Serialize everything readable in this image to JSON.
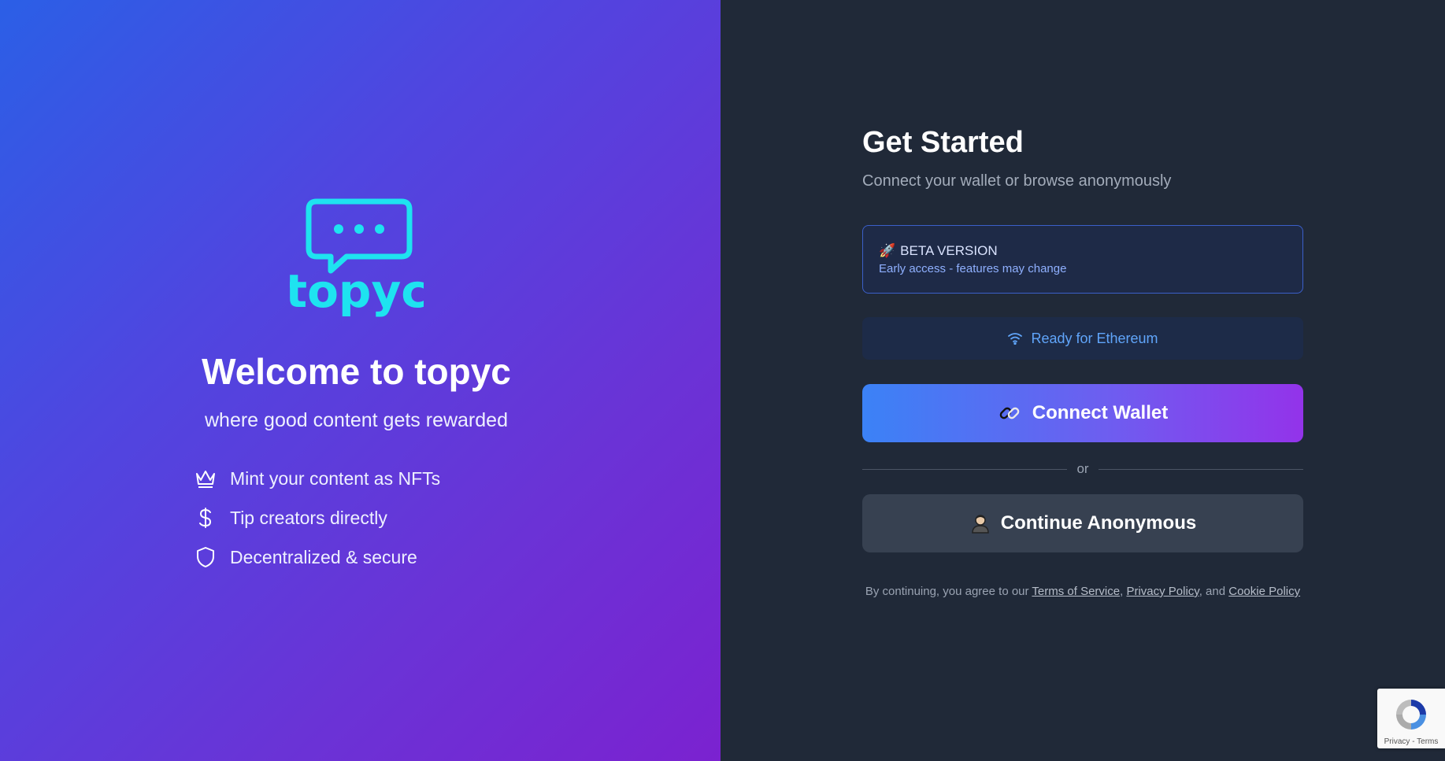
{
  "brand": {
    "name": "topyc",
    "logo_color": "#1ee3f0"
  },
  "welcome": {
    "title": "Welcome to topyc",
    "subtitle": "where good content gets rewarded",
    "features": [
      {
        "icon": "crown-icon",
        "label": "Mint your content as NFTs"
      },
      {
        "icon": "dollar-icon",
        "label": "Tip creators directly"
      },
      {
        "icon": "shield-icon",
        "label": "Decentralized & secure"
      }
    ]
  },
  "auth": {
    "title": "Get Started",
    "subtitle": "Connect your wallet or browse anonymously",
    "beta": {
      "icon": "rocket-icon",
      "title": "BETA VERSION",
      "description": "Early access - features may change"
    },
    "network_status": {
      "icon": "wifi-icon",
      "label": "Ready for Ethereum"
    },
    "connect_button": {
      "icon": "link-icon",
      "label": "Connect Wallet"
    },
    "divider_text": "or",
    "anonymous_button": {
      "icon": "incognito-icon",
      "label": "Continue Anonymous"
    },
    "terms": {
      "prefix": "By continuing, you agree to our ",
      "terms_link": "Terms of Service",
      "sep1": ", ",
      "privacy_link": "Privacy Policy",
      "sep2": ", and ",
      "cookie_link": "Cookie Policy"
    }
  },
  "recaptcha": {
    "privacy": "Privacy",
    "sep": " - ",
    "terms": "Terms"
  },
  "colors": {
    "left_gradient_start": "#2b5fe6",
    "left_gradient_end": "#7b22d0",
    "right_background": "#202938",
    "accent_blue": "#60a5fa",
    "button_gradient_start": "#3b82f6",
    "button_gradient_end": "#9333ea",
    "anonymous_button": "#374151"
  }
}
